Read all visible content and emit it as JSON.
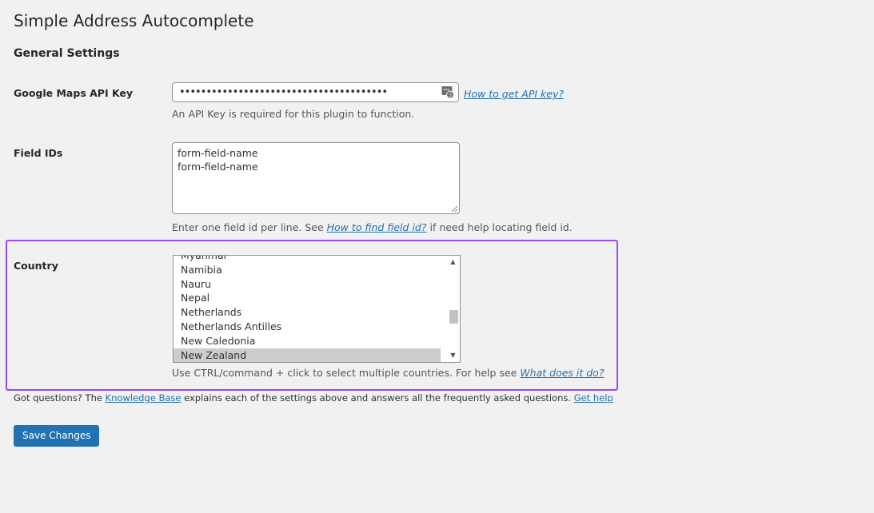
{
  "page": {
    "title": "Simple Address Autocomplete",
    "section_title": "General Settings"
  },
  "api_key": {
    "label": "Google Maps API Key",
    "value": "•••••••••••••••••••••••••••••••••••••••",
    "help_link": "How to get API key?",
    "description": "An API Key is required for this plugin to function.",
    "icon": "password-manager-icon"
  },
  "field_ids": {
    "label": "Field IDs",
    "value": "form-field-name\nform-field-name",
    "description_before": "Enter one field id per line. See ",
    "help_link": "How to find field id?",
    "description_after": " if need help locating field id."
  },
  "country": {
    "label": "Country",
    "options": [
      "Myanmar",
      "Namibia",
      "Nauru",
      "Nepal",
      "Netherlands",
      "Netherlands Antilles",
      "New Caledonia",
      "New Zealand"
    ],
    "selected": "New Zealand",
    "description_before": "Use CTRL/command + click to select multiple countries. For help see ",
    "help_link": "What does it do?"
  },
  "footer": {
    "text_before": "Got questions? The ",
    "kb_link": "Knowledge Base",
    "text_middle": " explains each of the settings above and answers all the frequently asked questions. ",
    "help_link": "Get help"
  },
  "actions": {
    "save_label": "Save Changes"
  },
  "colors": {
    "accent": "#2271b1",
    "highlight": "#9747ff",
    "background": "#f1f1f1"
  }
}
